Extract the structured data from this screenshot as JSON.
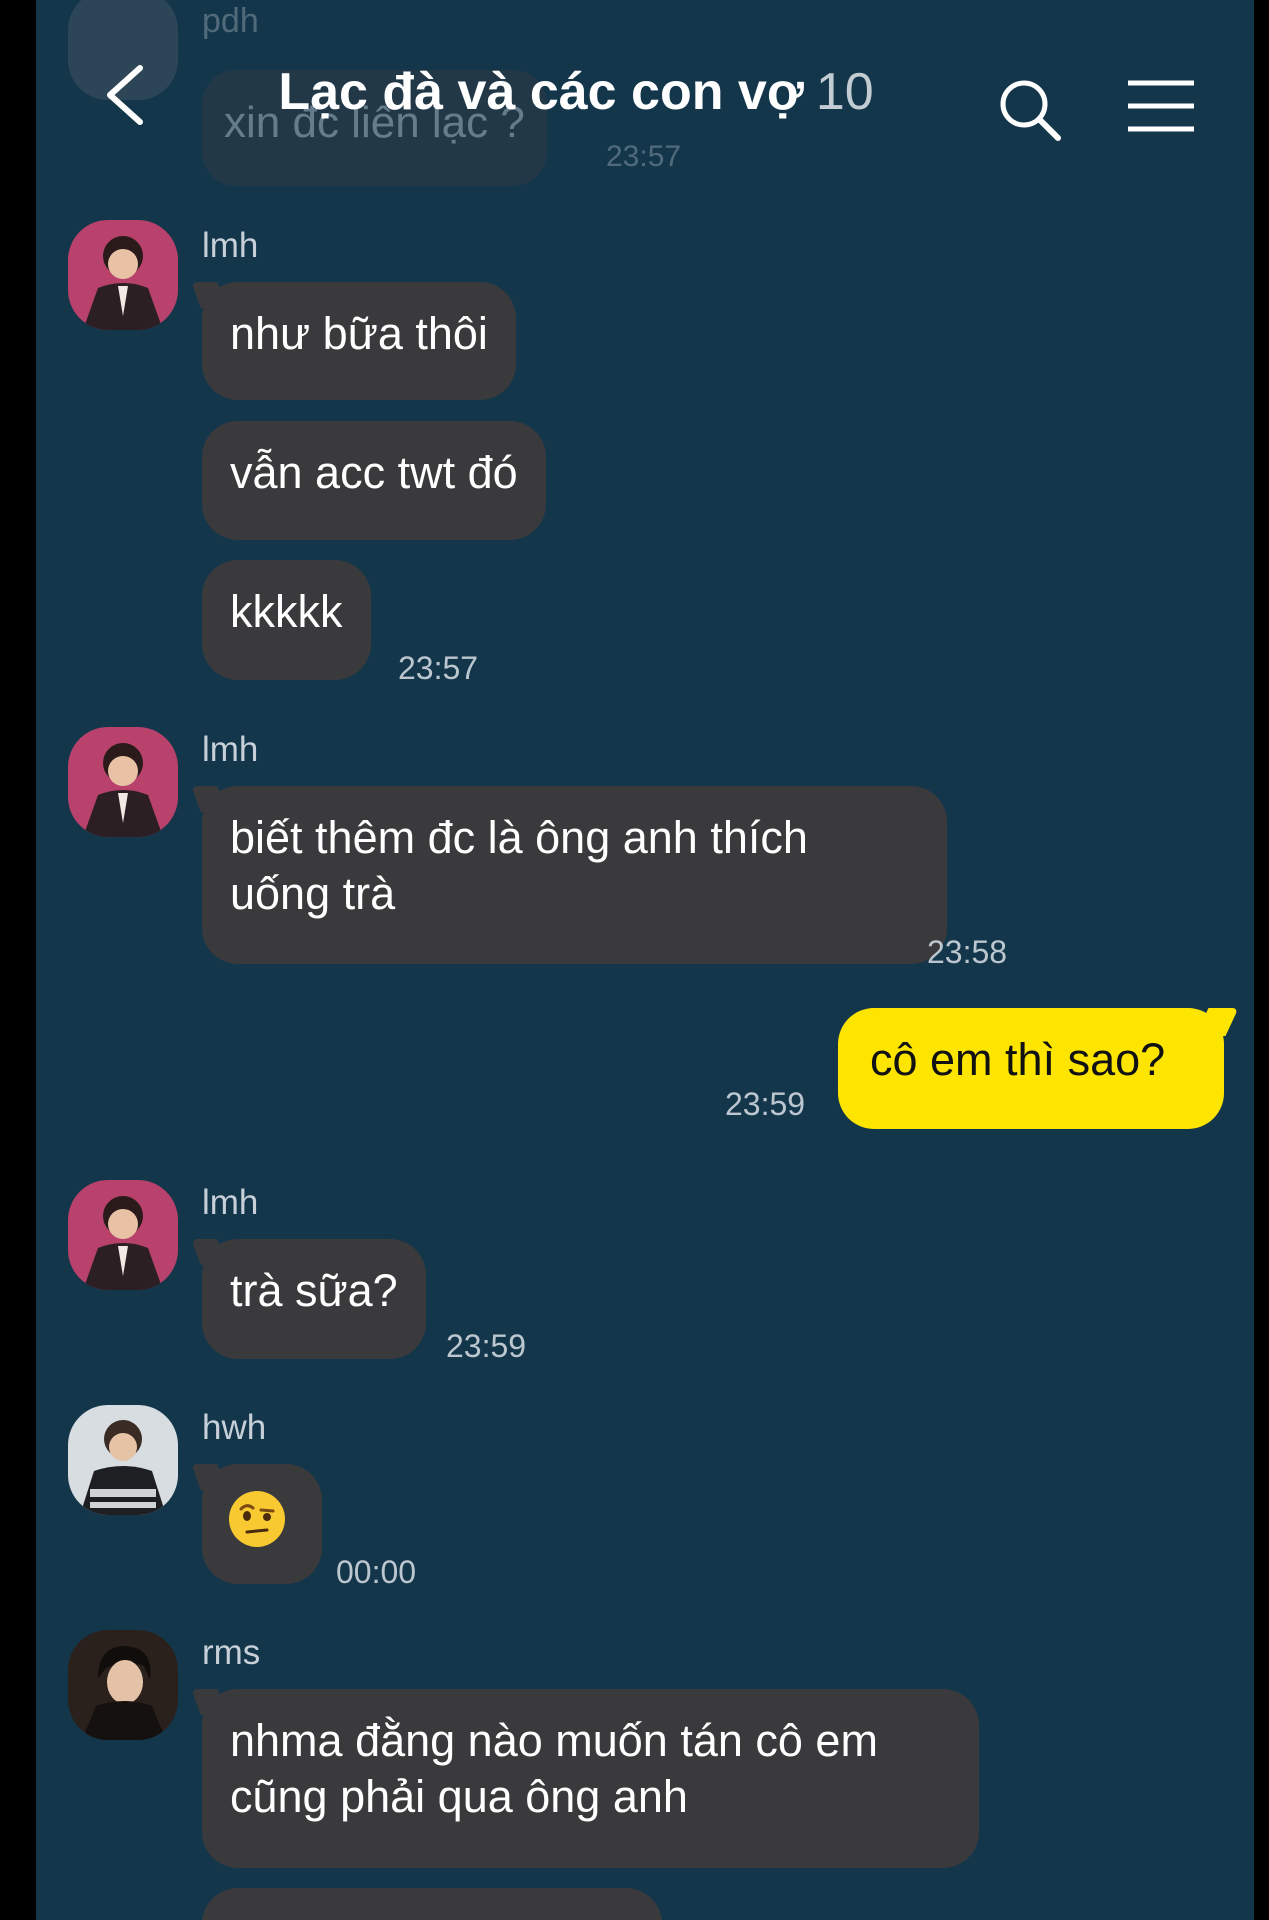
{
  "header": {
    "title": "Lạc đà và các con vợ",
    "member_count": "10"
  },
  "faded_message": {
    "sender": "pdh",
    "text": "xin đc liên lạc ?",
    "time": "23:57"
  },
  "messages": [
    {
      "sender": "lmh",
      "bubbles": [
        "như bữa thôi",
        "vẫn acc twt đó",
        "kkkkk"
      ],
      "time": "23:57"
    },
    {
      "sender": "lmh",
      "bubbles": [
        "biết thêm đc là ông anh thích\nuống trà"
      ],
      "time": "23:58"
    },
    {
      "sender": "me",
      "bubbles": [
        "cô em thì sao?"
      ],
      "time": "23:59"
    },
    {
      "sender": "lmh",
      "bubbles": [
        "trà sữa?"
      ],
      "time": "23:59"
    },
    {
      "sender": "hwh",
      "bubbles": [
        "face-with-raised-eyebrow-emoji"
      ],
      "time": "00:00"
    },
    {
      "sender": "rms",
      "bubbles": [
        "nhma đằng nào muốn tán cô em\ncũng phải qua ông anh"
      ],
      "time": ""
    }
  ],
  "colors": {
    "background": "#13364b",
    "incoming_bubble": "#3a3a3c",
    "outgoing_bubble": "#fde500"
  },
  "icons": {
    "back": "chevron-left-icon",
    "search": "search-icon",
    "menu": "hamburger-menu-icon"
  }
}
